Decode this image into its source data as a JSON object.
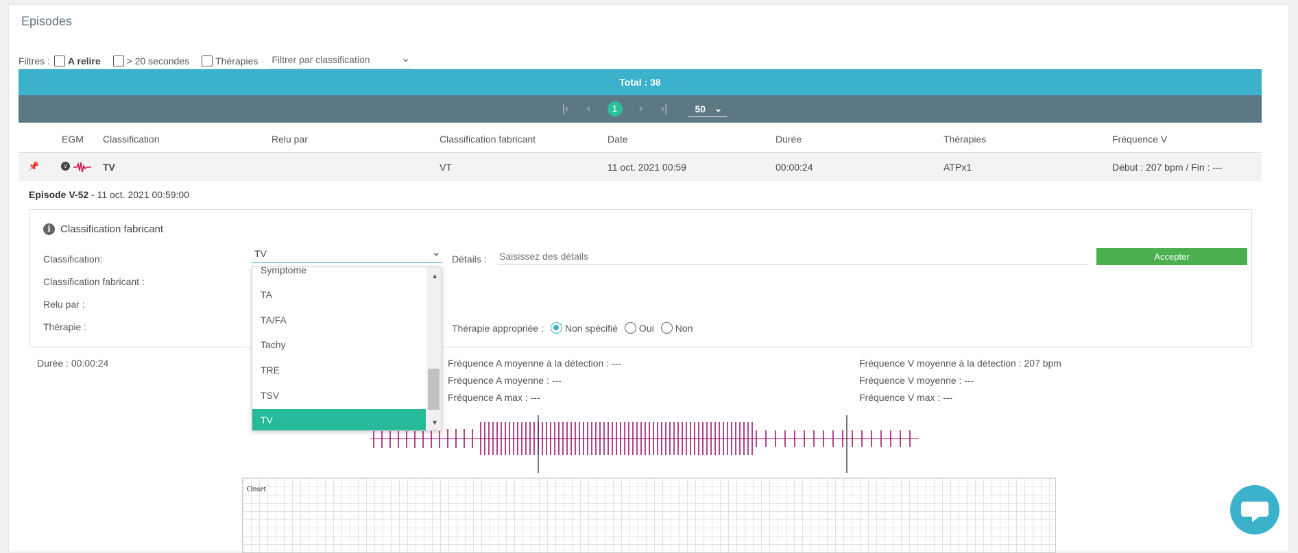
{
  "page": {
    "title": "Episodes"
  },
  "filters": {
    "label": "Filtres :",
    "a_relire": "A relire",
    "gt20": "> 20 secondes",
    "therapies": "Thérapies",
    "class_placeholder": "Filtrer par classification"
  },
  "total": "Total : 38",
  "pager": {
    "current_page": "1",
    "page_size": "50"
  },
  "table": {
    "headers": [
      "EGM",
      "Classification",
      "Relu par",
      "Classification fabricant",
      "Date",
      "Durée",
      "Thérapies",
      "Fréquence V"
    ],
    "row": {
      "classification": "TV",
      "classification_fabricant": "VT",
      "date": "11 oct. 2021 00:59",
      "duree": "00:00:24",
      "therapies": "ATPx1",
      "frequence_v": "Début : 207 bpm / Fin : ---"
    }
  },
  "episode": {
    "id": "Episode V-52",
    "datetime": " - 11 oct. 2021 00:59:00",
    "panel_title": "Classification fabricant",
    "classification_label": "Classification:",
    "classification_value": "TV",
    "classification_fabricant_label": "Classification fabricant :",
    "relu_par_label": "Relu par :",
    "therapie_label": "Thérapie :",
    "details_label": "Détails :",
    "details_placeholder": "Saisissez des détails",
    "accept_label": "Accepter",
    "therapie_appropriee_label": "Thérapie appropriée :",
    "radio_options": [
      "Non spécifié",
      "Oui",
      "Non"
    ],
    "radio_selected": "Non spécifié"
  },
  "dropdown": {
    "options": [
      "Symptome",
      "TA",
      "TA/FA",
      "Tachy",
      "TRE",
      "TSV",
      "TV"
    ],
    "selected": "TV"
  },
  "stats": {
    "duree_label": "Durée :",
    "duree_value": "00:00:24",
    "freq_a_detect_label": "Fréquence A moyenne à la détection :",
    "freq_a_detect_value": "---",
    "freq_a_moy_label": "Fréquence A moyenne :",
    "freq_a_moy_value": "---",
    "freq_a_max_label": "Fréquence A max :",
    "freq_a_max_value": "---",
    "freq_v_detect_label": "Fréquence V moyenne à la détection :",
    "freq_v_detect_value": "207 bpm",
    "freq_v_moy_label": "Fréquence V moyenne :",
    "freq_v_moy_value": "---",
    "freq_v_max_label": "Fréquence V max :",
    "freq_v_max_value": "---"
  },
  "egm": {
    "onset_label": "Onset",
    "trace_color": "#a0146e"
  },
  "colors": {
    "teal": "#3cb1cc",
    "pager": "#5d7885",
    "green": "#4caf50",
    "selected": "#26b99a"
  },
  "icons": [
    "pin-icon",
    "chevron-circle-down-icon",
    "ecg-wave-icon",
    "info-icon",
    "chat-icon"
  ]
}
